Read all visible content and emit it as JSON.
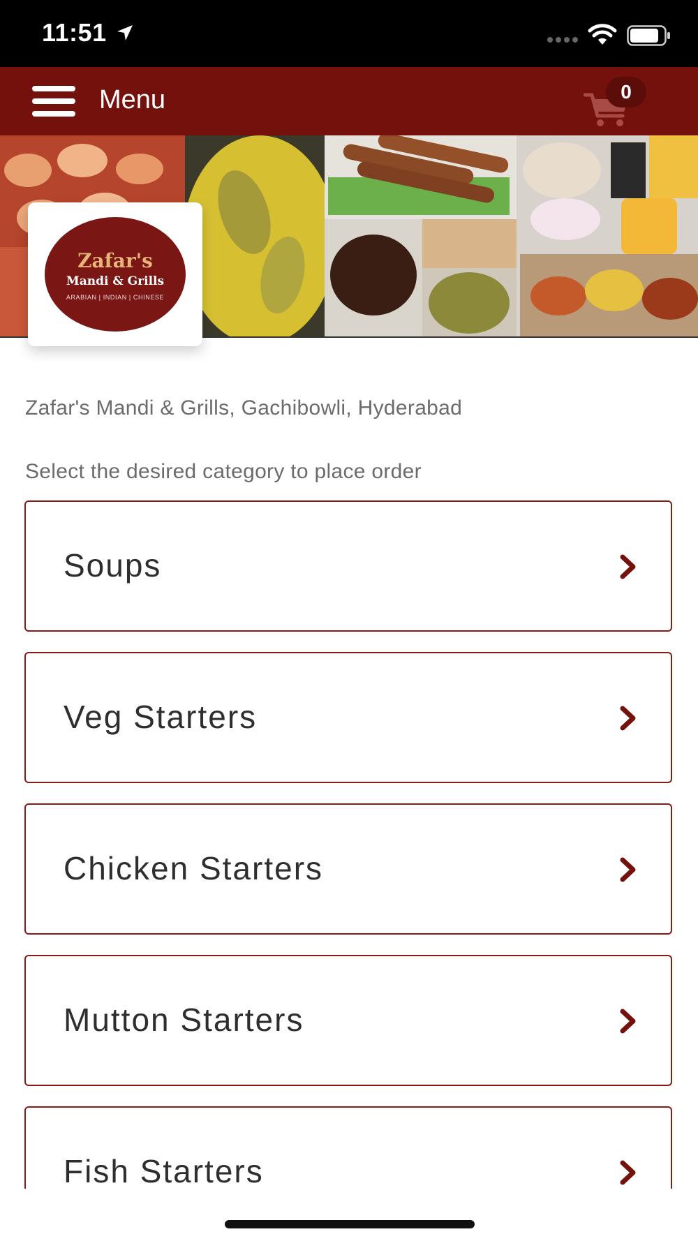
{
  "status_bar": {
    "time": "11:51"
  },
  "header": {
    "title": "Menu",
    "cart_count": "0"
  },
  "logo": {
    "line1": "Zafar's",
    "line2": "Mandi & Grills",
    "line3": "ARABIAN  |  INDIAN  |  CHINESE"
  },
  "restaurant": {
    "name": "Zafar's Mandi & Grills, Gachibowli, Hyderabad",
    "instruction": "Select the desired category to place order"
  },
  "categories": [
    {
      "label": "Soups"
    },
    {
      "label": "Veg Starters"
    },
    {
      "label": "Chicken Starters"
    },
    {
      "label": "Mutton Starters"
    },
    {
      "label": "Fish Starters"
    }
  ],
  "colors": {
    "brand": "#75110d",
    "card_border": "#8a1a17",
    "muted_text": "#6b6b6b"
  },
  "icons": [
    "location-arrow-icon",
    "signal-icon",
    "wifi-icon",
    "battery-icon",
    "hamburger-menu-icon",
    "cart-icon",
    "chevron-right-icon"
  ]
}
